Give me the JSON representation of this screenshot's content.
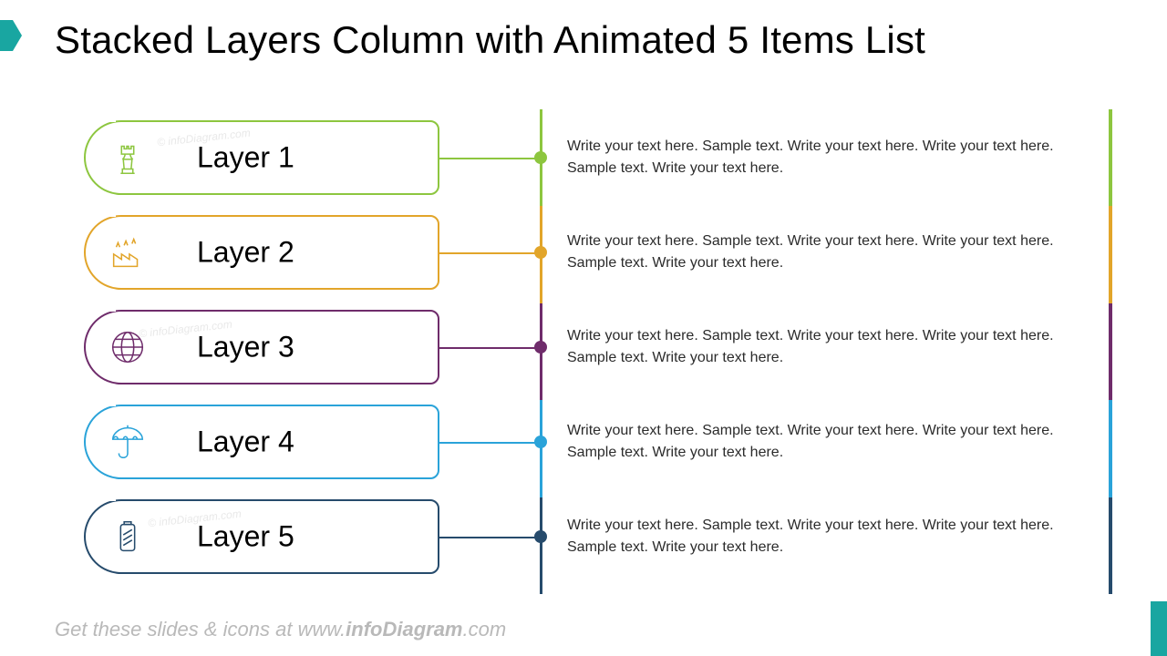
{
  "title": "Stacked Layers Column with Animated 5 Items List",
  "footer_prefix": "Get these slides & icons at www.",
  "footer_bold": "infoDiagram",
  "footer_suffix": ".com",
  "watermark": "© infoDiagram.com",
  "colors": {
    "accent": "#19a6a1",
    "accent_dark": "#117e7a"
  },
  "layers": [
    {
      "label": "Layer 1",
      "color": "#8dc63f",
      "color_dark": "#6aa02d",
      "icon": "chess-rook-icon",
      "desc": "Write your text here. Sample text. Write your text here. Write your text here. Sample text. Write your text here."
    },
    {
      "label": "Layer 2",
      "color": "#e2a52a",
      "color_dark": "#bd891f",
      "icon": "factory-icon",
      "desc": "Write your text here. Sample text. Write your text here. Write your text here. Sample text. Write your text here."
    },
    {
      "label": "Layer 3",
      "color": "#6f2c6b",
      "color_dark": "#4f1e4c",
      "icon": "globe-icon",
      "desc": "Write your text here. Sample text. Write your text here. Write your text here. Sample text. Write your text here."
    },
    {
      "label": "Layer 4",
      "color": "#2aa3d9",
      "color_dark": "#1f7da8",
      "icon": "umbrella-icon",
      "desc": "Write your text here. Sample text. Write your text here. Write your text here. Sample text. Write your text here."
    },
    {
      "label": "Layer 5",
      "color": "#264b6c",
      "color_dark": "#1a3850",
      "icon": "battery-icon",
      "desc": "Write your text here. Sample text. Write your text here. Write your text here. Sample text. Write your text here."
    }
  ]
}
